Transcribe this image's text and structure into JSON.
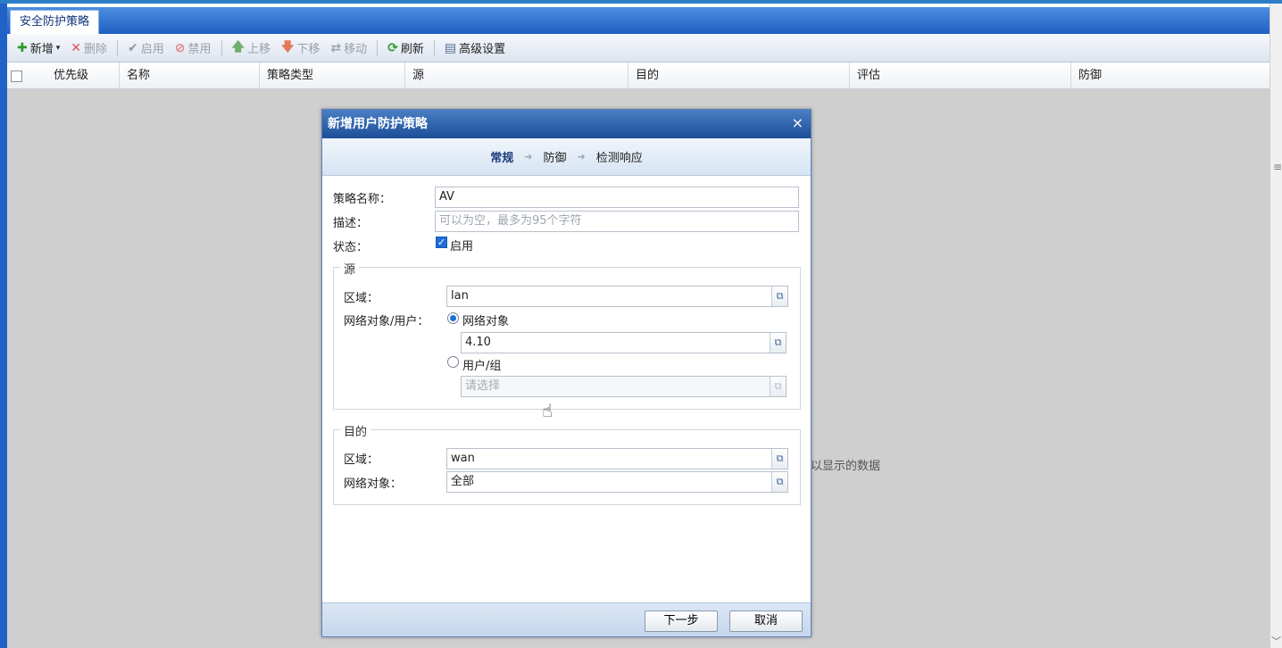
{
  "tab": {
    "label": "安全防护策略"
  },
  "toolbar": {
    "add": "新增",
    "delete": "删除",
    "enable": "启用",
    "disable": "禁用",
    "move_up": "上移",
    "move_down": "下移",
    "move": "移动",
    "refresh": "刷新",
    "advanced": "高级设置"
  },
  "grid": {
    "columns": [
      "优先级",
      "名称",
      "策略类型",
      "源",
      "目的",
      "评估",
      "防御"
    ],
    "empty_text": "以显示的数据"
  },
  "dialog": {
    "title": "新增用户防护策略",
    "close": "×",
    "steps": [
      "常规",
      "防御",
      "检测响应"
    ],
    "policy_name_label": "策略名称：",
    "policy_name_value": "AV",
    "description_label": "描述：",
    "description_placeholder": "可以为空，最多为95个字符",
    "status_label": "状态：",
    "status_checkbox_label": "启用",
    "source": {
      "legend": "源",
      "zone_label": "区域：",
      "zone_value": "lan",
      "object_label": "网络对象/用户：",
      "radio_network_object": "网络对象",
      "network_object_value": "4.10",
      "radio_user_group": "用户/组",
      "user_group_placeholder": "请选择"
    },
    "destination": {
      "legend": "目的",
      "zone_label": "区域：",
      "zone_value": "wan",
      "object_label": "网络对象：",
      "object_value": "全部"
    },
    "next_button": "下一步",
    "cancel_button": "取消"
  }
}
